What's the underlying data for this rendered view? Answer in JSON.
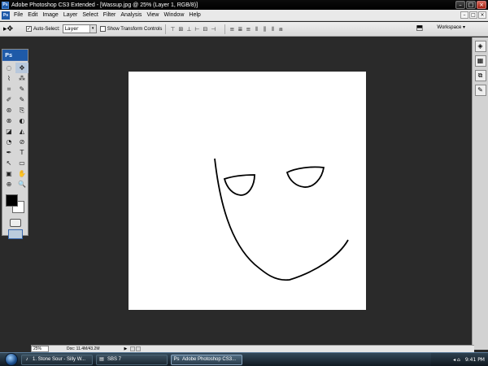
{
  "titlebar": {
    "app_icon_text": "Ps",
    "title": "Adobe Photoshop CS3 Extended - [Wassup.jpg @ 25% (Layer 1, RGB/8)]",
    "minimize": "–",
    "maximize": "□",
    "close": "×"
  },
  "menubar": {
    "icon_text": "Ps",
    "items": [
      "File",
      "Edit",
      "Image",
      "Layer",
      "Select",
      "Filter",
      "Analysis",
      "View",
      "Window",
      "Help"
    ],
    "doc_minimize": "–",
    "doc_restore": "□",
    "doc_close": "×"
  },
  "options": {
    "tool_glyph": "▸✥",
    "auto_select_check": "✓",
    "auto_select_label": "Auto-Select:",
    "auto_select_value": "Layer",
    "select_arrow": "▾",
    "transform_label": "Show Transform Controls",
    "workspace_label": "Workspace ▾",
    "bridge_icon": "⬒"
  },
  "toolspanel": {
    "header": "Ps",
    "tools": [
      "◌",
      "✥",
      "⌇",
      "⁂",
      "⌗",
      "✎",
      "✐",
      "✎",
      "⊛",
      "⎘",
      "⊗",
      "◐",
      "◪",
      "◭",
      "◔",
      "⊘",
      "✒",
      "T",
      "↖",
      "▭",
      "▣",
      "✋",
      "⊕",
      "🔍"
    ]
  },
  "dock": {
    "items": [
      "◈",
      "▦",
      "⧉",
      "✎"
    ]
  },
  "statusbar": {
    "zoom": "25%",
    "doc_info": "Doc: 11.4M/43.2M",
    "play": "▶"
  },
  "taskbar": {
    "tasks": [
      {
        "icon": "♪",
        "label": "1. Stone Sour - Silly W..."
      },
      {
        "icon": "▤",
        "label": "SBS 7"
      },
      {
        "icon": "Ps",
        "label": "Adobe Photoshop CS3..."
      }
    ],
    "tray_icons": "◂ ⌂",
    "clock": "9:41 PM"
  }
}
